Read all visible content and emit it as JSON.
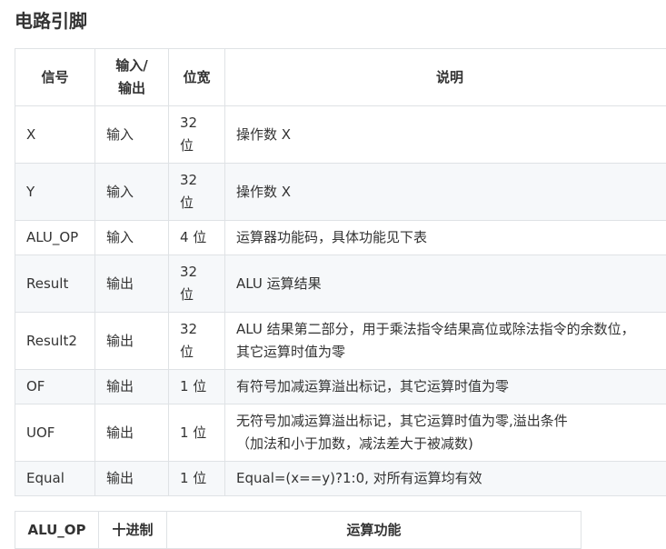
{
  "heading": "电路引脚",
  "pin_table": {
    "headers": [
      "信号",
      "输入/\n输出",
      "位宽",
      "说明"
    ],
    "rows": [
      [
        "X",
        "输入",
        "32\n位",
        "操作数 X"
      ],
      [
        "Y",
        "输入",
        "32\n位",
        "操作数 X"
      ],
      [
        "ALU_OP",
        "输入",
        "4 位",
        "运算器功能码，具体功能见下表"
      ],
      [
        "Result",
        "输出",
        "32\n位",
        "ALU 运算结果"
      ],
      [
        "Result2",
        "输出",
        "32\n位",
        "ALU 结果第二部分，用于乘法指令结果高位或除法指令的余数位，\n其它运算时值为零"
      ],
      [
        "OF",
        "输出",
        "1 位",
        "有符号加减运算溢出标记，其它运算时值为零"
      ],
      [
        "UOF",
        "输出",
        "1 位",
        "无符号加减运算溢出标记，其它运算时值为零,溢出条件\n（加法和小于加数，减法差大于被减数)"
      ],
      [
        "Equal",
        "输出",
        "1 位",
        "Equal=(x==y)?1:0, 对所有运算均有效"
      ]
    ]
  },
  "op_table": {
    "headers": [
      "ALU_OP",
      "十进制",
      "运算功能"
    ]
  }
}
